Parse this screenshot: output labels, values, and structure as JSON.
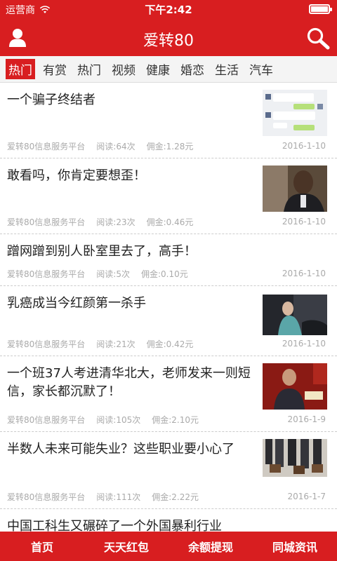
{
  "status_bar": {
    "carrier": "运营商",
    "time": "下午2:42"
  },
  "header": {
    "title": "爱转80"
  },
  "tabs": [
    {
      "label": "热门",
      "active": true
    },
    {
      "label": "有赏"
    },
    {
      "label": "热门"
    },
    {
      "label": "视频"
    },
    {
      "label": "健康"
    },
    {
      "label": "婚恋"
    },
    {
      "label": "生活"
    },
    {
      "label": "汽车"
    }
  ],
  "articles": [
    {
      "title": "一个骗子终结者",
      "source": "爱转80信息服务平台",
      "reads": "阅读:64次",
      "commission": "佣金:1.28元",
      "date": "2016-1-10",
      "thumb": "chat-screenshot"
    },
    {
      "title": "敢看吗，你肯定要想歪！",
      "source": "爱转80信息服务平台",
      "reads": "阅读:23次",
      "commission": "佣金:0.46元",
      "date": "2016-1-10",
      "thumb": "smiling-man"
    },
    {
      "title": "蹭网蹭到别人卧室里去了，高手！",
      "source": "爱转80信息服务平台",
      "reads": "阅读:5次",
      "commission": "佣金:0.10元",
      "date": "2016-1-10",
      "thumb": ""
    },
    {
      "title": "乳癌成当今红颜第一杀手",
      "source": "爱转80信息服务平台",
      "reads": "阅读:21次",
      "commission": "佣金:0.42元",
      "date": "2016-1-10",
      "thumb": "woman-car-show"
    },
    {
      "title": "一个班37人考进清华北大，老师发来一则短信，家长都沉默了！",
      "source": "爱转80信息服务平台",
      "reads": "阅读:105次",
      "commission": "佣金:2.10元",
      "date": "2016-1-9",
      "thumb": "speaker-podium"
    },
    {
      "title": "半数人未来可能失业？这些职业要小心了",
      "source": "爱转80信息服务平台",
      "reads": "阅读:111次",
      "commission": "佣金:2.22元",
      "date": "2016-1-7",
      "thumb": "briefcases-crowd"
    },
    {
      "title": "中国工科生又碾碎了一个外国暴利行业",
      "source": "",
      "reads": "",
      "commission": "",
      "date": "",
      "thumb": ""
    }
  ],
  "bottom_nav": [
    {
      "label": "首页"
    },
    {
      "label": "天天红包"
    },
    {
      "label": "余额提现"
    },
    {
      "label": "同城资讯"
    }
  ],
  "colors": {
    "brand_red": "#d81e20",
    "meta_gray": "#aaaaaa"
  }
}
